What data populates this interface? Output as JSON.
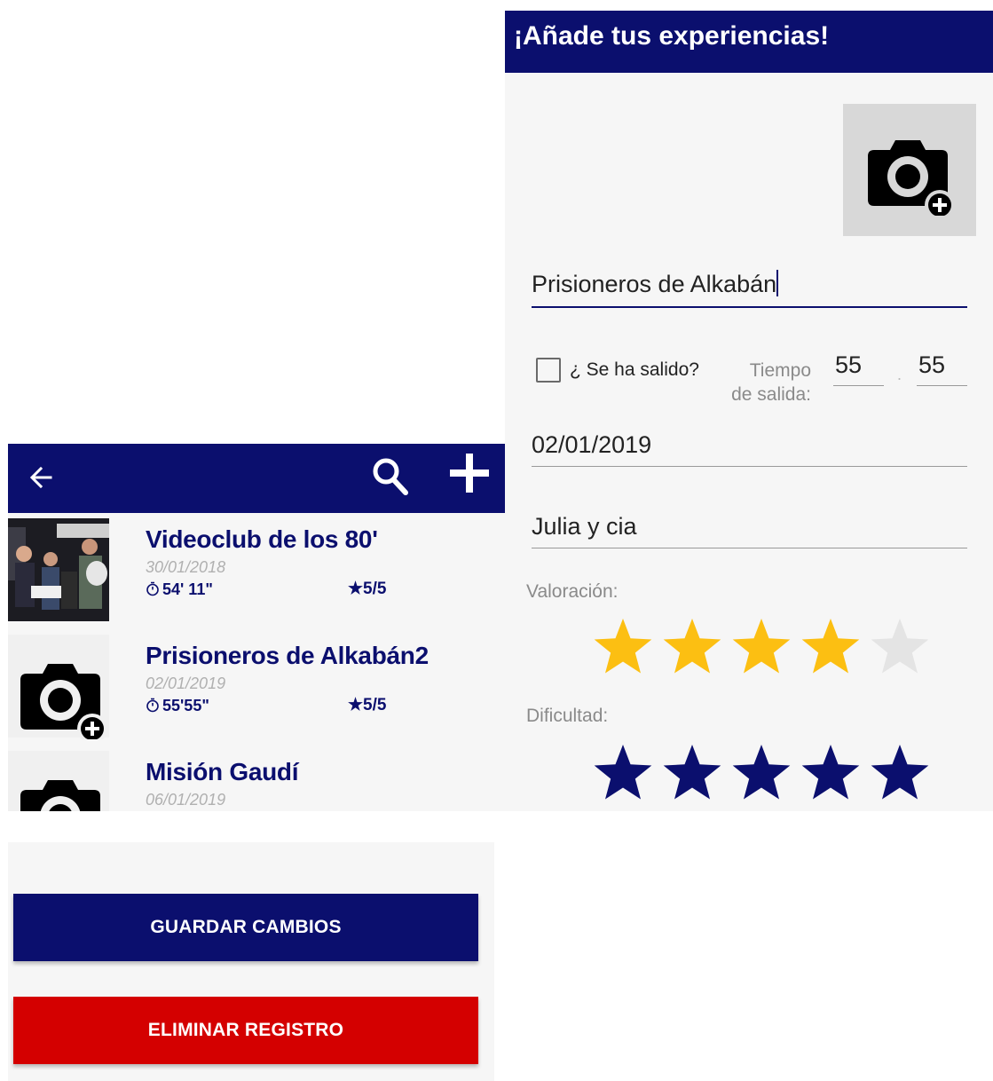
{
  "form": {
    "title": "¡Añade tus experiencias!",
    "photo_button_icon": "add-a-photo-icon",
    "name_value": "Prisioneros de Alkabán",
    "exit_checkbox_label": "¿ Se ha salido?",
    "exit_checked": false,
    "exit_time_label_line1": "Tiempo",
    "exit_time_label_line2": "de salida:",
    "exit_minutes": "55",
    "exit_seconds": "55",
    "date_value": "02/01/2019",
    "people_value": "Julia y cia",
    "rating_label": "Valoración:",
    "rating_value": 4,
    "rating_max": 5,
    "difficulty_label": "Dificultad:",
    "difficulty_value": 5,
    "difficulty_max": 5
  },
  "list": {
    "toolbar_icons": [
      "back-arrow-icon",
      "search-icon",
      "add-icon"
    ],
    "items": [
      {
        "title": "Videoclub de los 80'",
        "date": "30/01/2018",
        "time": "54' 11\"",
        "score": "5/5",
        "thumb": "photo"
      },
      {
        "title": "Prisioneros de Alkabán2",
        "date": "02/01/2019",
        "time": "55'55\"",
        "score": "5/5",
        "thumb": "add-a-photo-icon"
      },
      {
        "title": "Misión Gaudí",
        "date": "06/01/2019",
        "thumb": "add-a-photo-icon"
      }
    ]
  },
  "actions": {
    "save_label": "GUARDAR CAMBIOS",
    "delete_label": "ELIMINAR REGISTRO"
  },
  "colors": {
    "primary": "#0b0f6e",
    "danger": "#d40000",
    "star_gold": "#fcbf12",
    "star_empty": "#e4e4e4",
    "star_navy": "#0b0f6e",
    "background": "#f6f6f6"
  }
}
